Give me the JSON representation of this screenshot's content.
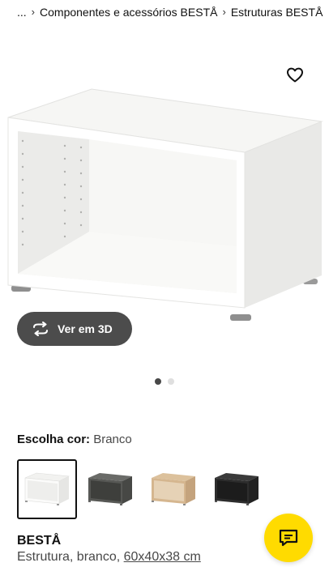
{
  "breadcrumb": {
    "ellipsis": "...",
    "items": [
      "Componentes e acessórios BESTÅ",
      "Estruturas BESTÅ"
    ]
  },
  "favorite": {
    "icon": "heart-outline-icon"
  },
  "viewer": {
    "button_label": "Ver em 3D",
    "icon": "rotate-3d-icon",
    "carousel": {
      "count": 2,
      "active": 1
    }
  },
  "color_choice": {
    "label": "Escolha cor:",
    "value": "Branco",
    "options": [
      {
        "name": "white",
        "color": "#f4f4f2",
        "selected": true
      },
      {
        "name": "dark-grey",
        "color": "#535451",
        "selected": false
      },
      {
        "name": "oak-effect",
        "color": "#d2b38d",
        "selected": false
      },
      {
        "name": "black-brown",
        "color": "#2f2f2f",
        "selected": false
      }
    ]
  },
  "product": {
    "name": "BESTÅ",
    "description_prefix": "Estrutura, branco,",
    "dimensions": "60x40x38 cm"
  },
  "chat": {
    "icon": "chat-icon",
    "color": "#ffdb00"
  }
}
